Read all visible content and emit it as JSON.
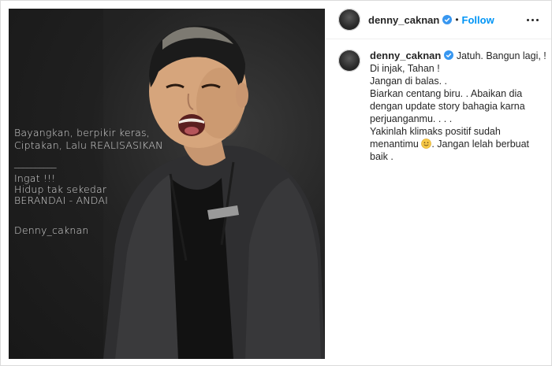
{
  "photo": {
    "overlay_lines": [
      "Bayangkan, berpikir keras,",
      "Ciptakan, Lalu REALISASIKAN",
      "__________",
      "Ingat !!!",
      "Hidup tak sekedar",
      "BERANDAI - ANDAI",
      "",
      "Denny_caknan"
    ]
  },
  "header": {
    "username": "denny_caknan",
    "verified_icon": "verified-badge-icon",
    "separator": "•",
    "follow_label": "Follow",
    "more_icon": "more-options-icon"
  },
  "caption": {
    "username": "denny_caknan",
    "first_line": "Jatuh. Bangun lagi, !",
    "lines": [
      "Di injak, Tahan !",
      "Jangan di balas. .",
      "Biarkan centang biru. . Abaikan dia",
      "dengan update story bahagia karna",
      "perjuanganmu. . . .",
      "Yakinlah klimaks positif sudah"
    ],
    "emoji_line_before": "menantimu",
    "emoji_icon": "smiling-face-emoji",
    "emoji_line_after": ". Jangan lelah berbuat",
    "last_line": "baik ."
  },
  "colors": {
    "accent": "#0095f6",
    "text": "#262626",
    "photo_bg": "#1e1e1e"
  }
}
